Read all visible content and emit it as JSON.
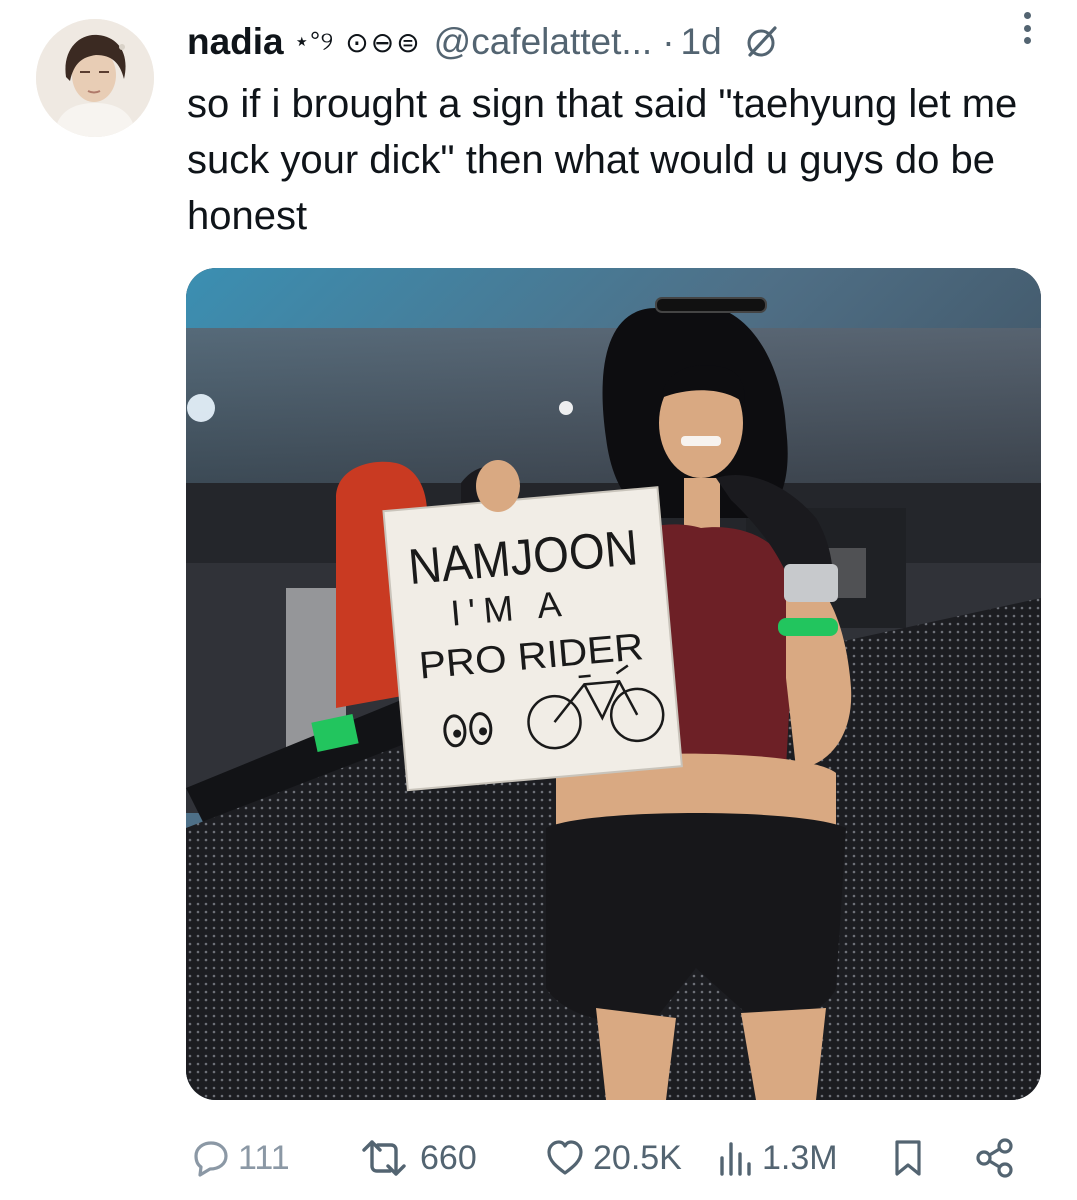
{
  "author": {
    "display_name": "nadia",
    "name_decoration": "⋆°୨",
    "name_emojis": "⊙⊖⊜",
    "handle": "@cafelattet...",
    "separator": "·",
    "time": "1d"
  },
  "tweet": {
    "text": "so if i brought a sign that said \"taehyung let me suck your dick\" then what would u guys do be honest"
  },
  "media": {
    "sign_lines": [
      "NAMJOON",
      "I'M A",
      "PRO RIDER"
    ]
  },
  "actions": {
    "replies": "111",
    "reposts": "660",
    "likes": "20.5K",
    "views": "1.3M"
  },
  "colors": {
    "text": "#0f1419",
    "secondary": "#536471"
  },
  "icons": [
    "grok-icon",
    "more-icon",
    "reply-icon",
    "repost-icon",
    "like-icon",
    "views-icon",
    "bookmark-icon",
    "share-icon"
  ]
}
